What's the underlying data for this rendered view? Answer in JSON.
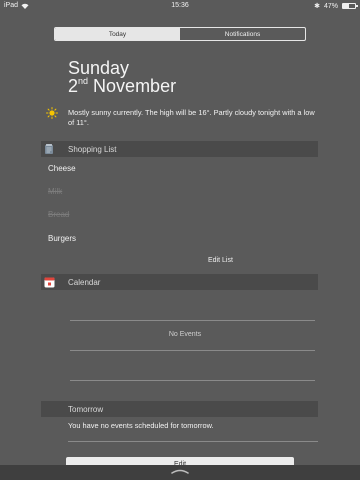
{
  "status_bar": {
    "carrier": "iPad",
    "time": "15:36",
    "battery": "47%",
    "battery_level": 0.47,
    "bluetooth_glyph": "✱"
  },
  "tabs": {
    "today": "Today",
    "notifications": "Notifications",
    "selected": "Today"
  },
  "date": {
    "weekday": "Sunday",
    "day": "2",
    "ordinal": "nd",
    "month": "November"
  },
  "weather": {
    "icon": "sun-icon",
    "summary": "Mostly sunny currently. The high will be 16°. Partly cloudy tonight with a low of 11°."
  },
  "shopping_list": {
    "title": "Shopping List",
    "icon": "shopping-list-app-icon",
    "items": [
      {
        "label": "Cheese",
        "done": false
      },
      {
        "label": "Milk",
        "done": true
      },
      {
        "label": "Bread",
        "done": true
      },
      {
        "label": "Burgers",
        "done": false
      }
    ],
    "edit_label": "Edit List"
  },
  "calendar": {
    "title": "Calendar",
    "icon": "calendar-app-icon",
    "empty_label": "No Events"
  },
  "tomorrow": {
    "title": "Tomorrow",
    "message": "You have no events scheduled for tomorrow."
  },
  "footer": {
    "edit_label": "Edit"
  },
  "colors": {
    "background": "#5a5a5a",
    "header_bg": "#4a4a4a",
    "text": "#f2f2f2",
    "sun": "#f5c400",
    "calendar_red": "#e0453c"
  }
}
